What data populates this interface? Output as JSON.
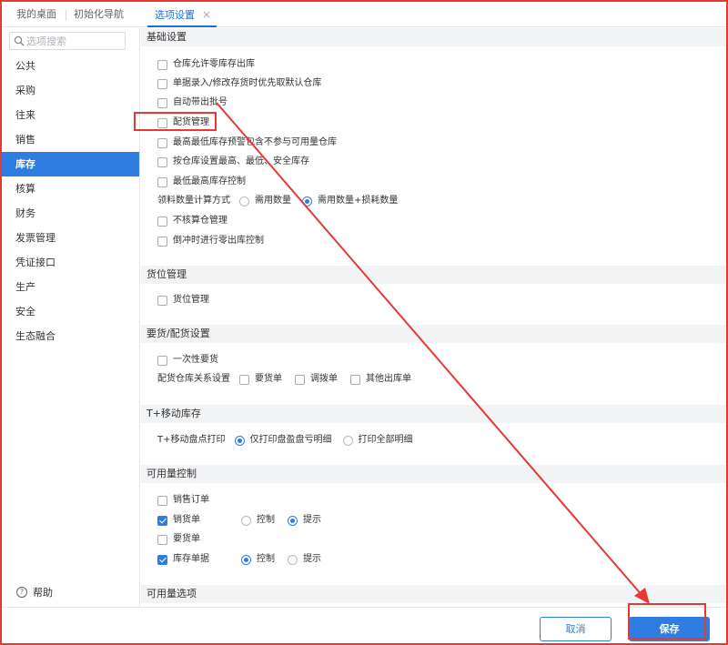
{
  "tabs": [
    {
      "label": "我的桌面"
    },
    {
      "label": "初始化导航"
    },
    {
      "label": "选项设置",
      "close": "×"
    }
  ],
  "search": {
    "placeholder": "选项搜索"
  },
  "sidebar": {
    "items": [
      {
        "label": "公共"
      },
      {
        "label": "采购"
      },
      {
        "label": "往来"
      },
      {
        "label": "销售"
      },
      {
        "label": "库存",
        "active": true
      },
      {
        "label": "核算"
      },
      {
        "label": "财务"
      },
      {
        "label": "发票管理"
      },
      {
        "label": "凭证接口"
      },
      {
        "label": "生产"
      },
      {
        "label": "安全"
      },
      {
        "label": "生态融合"
      }
    ],
    "help": "帮助"
  },
  "sections": {
    "basic": {
      "title": "基础设置",
      "items": [
        {
          "label": "仓库允许零库存出库",
          "checked": false
        },
        {
          "label": "单据录入/修改存货时优先取默认仓库",
          "checked": false
        },
        {
          "label": "自动带出批号",
          "checked": false
        },
        {
          "label": "配货管理",
          "checked": false
        },
        {
          "label": "最高最低库存预警包含不参与可用量仓库",
          "checked": false
        },
        {
          "label": "按仓库设置最高、最低、安全库存",
          "checked": false
        },
        {
          "label": "最低最高库存控制",
          "checked": false
        }
      ],
      "material_calc": {
        "label": "领料数量计算方式",
        "options": [
          {
            "label": "需用数量",
            "selected": false
          },
          {
            "label": "需用数量+损耗数量",
            "selected": true
          }
        ]
      },
      "items2": [
        {
          "label": "不核算仓管理",
          "checked": false
        },
        {
          "label": "倒冲时进行零出库控制",
          "checked": false
        }
      ]
    },
    "location": {
      "title": "货位管理",
      "items": [
        {
          "label": "货位管理",
          "checked": false
        }
      ]
    },
    "requisition": {
      "title": "要货/配货设置",
      "items": [
        {
          "label": "一次性要货",
          "checked": false
        }
      ],
      "relation": {
        "label": "配货仓库关系设置",
        "options": [
          {
            "label": "要货单",
            "checked": false
          },
          {
            "label": "调拨单",
            "checked": false
          },
          {
            "label": "其他出库单",
            "checked": false
          }
        ]
      }
    },
    "mobile": {
      "title": "T+移动库存",
      "print": {
        "label": "T+移动盘点打印",
        "options": [
          {
            "label": "仅打印盘盈盘亏明细",
            "selected": true
          },
          {
            "label": "打印全部明细",
            "selected": false
          }
        ]
      }
    },
    "available": {
      "title": "可用量控制",
      "rows": [
        {
          "label": "销售订单",
          "checked": false
        },
        {
          "label": "销货单",
          "checked": true,
          "control": "控制",
          "prompt": "提示",
          "mode": "prompt"
        },
        {
          "label": "要货单",
          "checked": false
        },
        {
          "label": "库存单据",
          "checked": true,
          "control": "控制",
          "prompt": "提示",
          "mode": "control"
        }
      ]
    },
    "available_options": {
      "title": "可用量选项"
    }
  },
  "footer": {
    "cancel": "取消",
    "save": "保存"
  },
  "colors": {
    "accent": "#2f7de1",
    "annotation": "#e53935"
  }
}
